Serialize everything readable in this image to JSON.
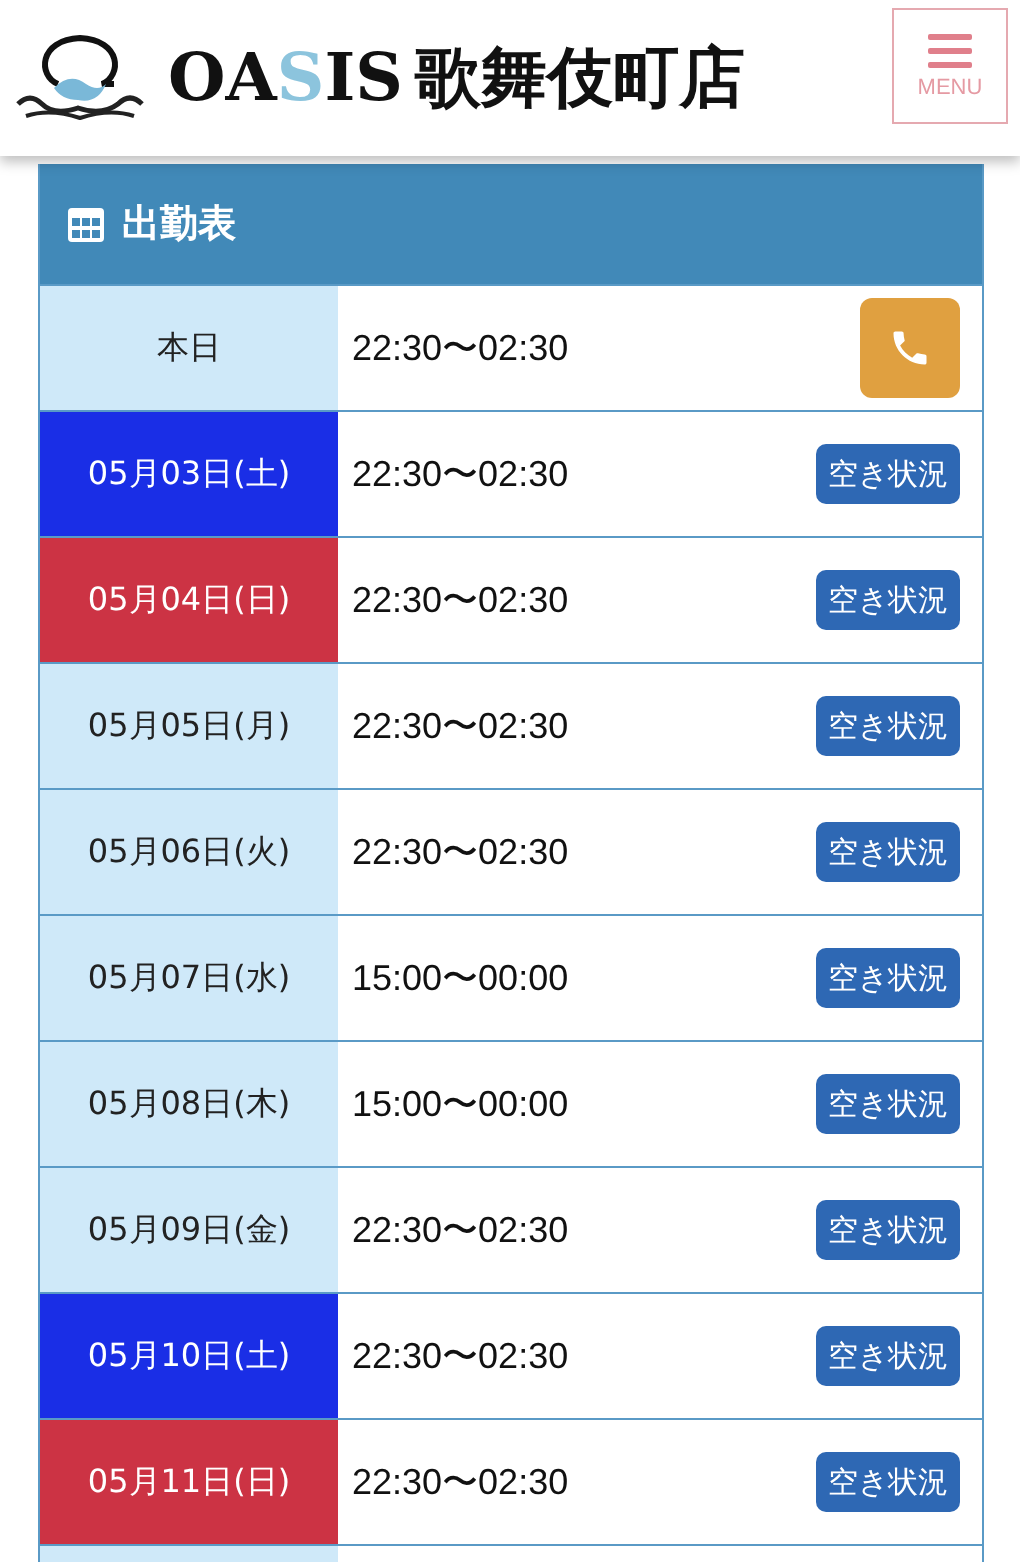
{
  "header": {
    "logo": {
      "parts": [
        {
          "text": "OA",
          "accent": false
        },
        {
          "text": "S",
          "accent": true
        },
        {
          "text": "IS",
          "accent": false
        }
      ],
      "suffix": "歌舞伎町店"
    },
    "menu_label": "MENU"
  },
  "schedule": {
    "title": "出勤表",
    "rows": [
      {
        "kind": "today",
        "date": "本日",
        "color": "#cfe9f9",
        "time": "22:30〜02:30"
      },
      {
        "kind": "day",
        "date": "05月03日(土)",
        "color": "#1a2ee6",
        "time": "22:30〜02:30",
        "button": "空き状況"
      },
      {
        "kind": "day",
        "date": "05月04日(日)",
        "color": "#cc3344",
        "time": "22:30〜02:30",
        "button": "空き状況"
      },
      {
        "kind": "day",
        "date": "05月05日(月)",
        "color": "#cfe9f9",
        "time": "22:30〜02:30",
        "button": "空き状況"
      },
      {
        "kind": "day",
        "date": "05月06日(火)",
        "color": "#cfe9f9",
        "time": "22:30〜02:30",
        "button": "空き状況"
      },
      {
        "kind": "day",
        "date": "05月07日(水)",
        "color": "#cfe9f9",
        "time": "15:00〜00:00",
        "button": "空き状況"
      },
      {
        "kind": "day",
        "date": "05月08日(木)",
        "color": "#cfe9f9",
        "time": "15:00〜00:00",
        "button": "空き状況"
      },
      {
        "kind": "day",
        "date": "05月09日(金)",
        "color": "#cfe9f9",
        "time": "22:30〜02:30",
        "button": "空き状況"
      },
      {
        "kind": "day",
        "date": "05月10日(土)",
        "color": "#1a2ee6",
        "time": "22:30〜02:30",
        "button": "空き状況"
      },
      {
        "kind": "day",
        "date": "05月11日(日)",
        "color": "#cc3344",
        "time": "22:30〜02:30",
        "button": "空き状況"
      }
    ]
  }
}
